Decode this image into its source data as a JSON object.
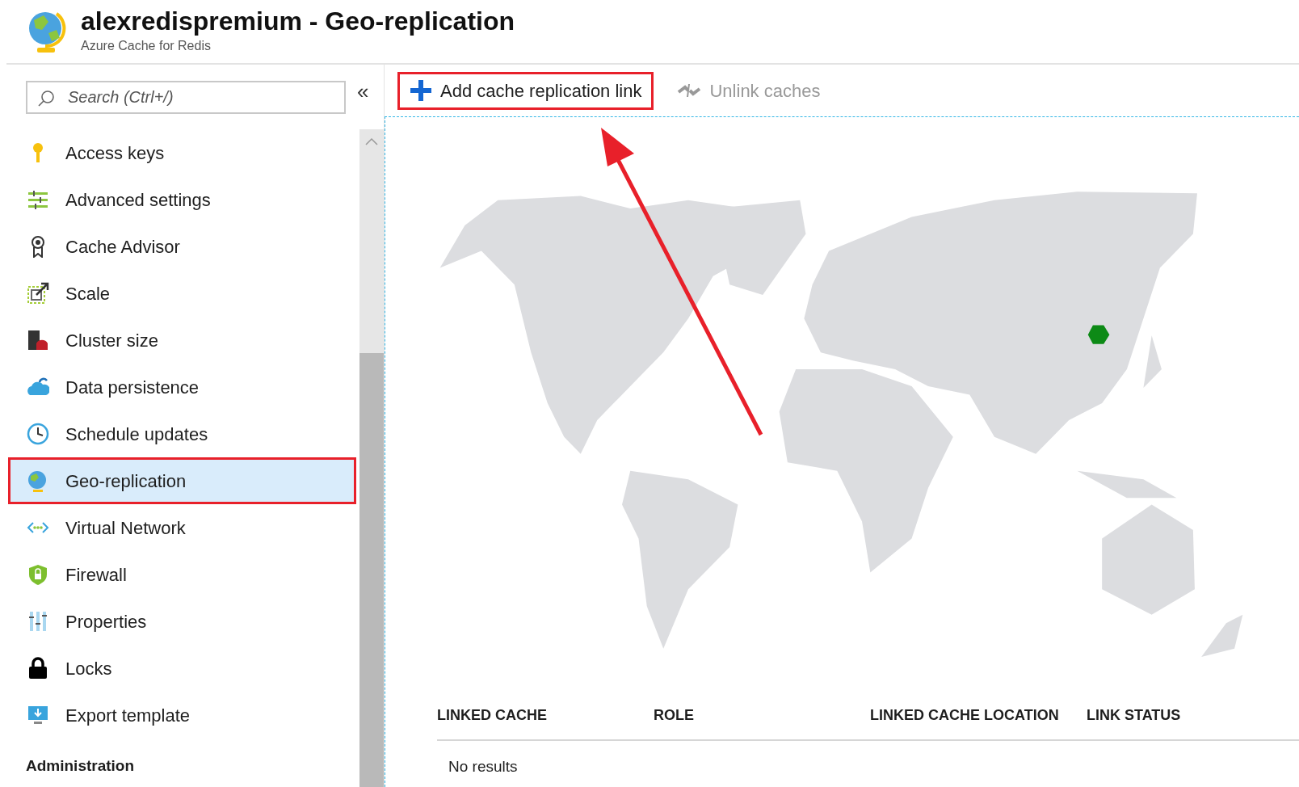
{
  "header": {
    "title": "alexredispremium - Geo-replication",
    "subtitle": "Azure Cache for Redis"
  },
  "sidebar": {
    "search": {
      "placeholder": "Search (Ctrl+/)"
    },
    "collapse": "«",
    "items": [
      {
        "label": "Access keys",
        "selected": false,
        "highlighted": false
      },
      {
        "label": "Advanced settings",
        "selected": false,
        "highlighted": false
      },
      {
        "label": "Cache Advisor",
        "selected": false,
        "highlighted": false
      },
      {
        "label": "Scale",
        "selected": false,
        "highlighted": false
      },
      {
        "label": "Cluster size",
        "selected": false,
        "highlighted": false
      },
      {
        "label": "Data persistence",
        "selected": false,
        "highlighted": false
      },
      {
        "label": "Schedule updates",
        "selected": false,
        "highlighted": false
      },
      {
        "label": "Geo-replication",
        "selected": true,
        "highlighted": true
      },
      {
        "label": "Virtual Network",
        "selected": false,
        "highlighted": false
      },
      {
        "label": "Firewall",
        "selected": false,
        "highlighted": false
      },
      {
        "label": "Properties",
        "selected": false,
        "highlighted": false
      },
      {
        "label": "Locks",
        "selected": false,
        "highlighted": false
      },
      {
        "label": "Export template",
        "selected": false,
        "highlighted": false
      }
    ],
    "section": "Administration"
  },
  "toolbar": [
    {
      "kind": "add",
      "label": "Add cache replication link",
      "disabled": false,
      "highlighted": true
    },
    {
      "kind": "unlink",
      "label": "Unlink caches",
      "disabled": true,
      "highlighted": false
    }
  ],
  "table": {
    "columns": [
      "LINKED CACHE",
      "ROLE",
      "LINKED CACHE LOCATION",
      "LINK STATUS"
    ],
    "empty_text": "No results"
  }
}
